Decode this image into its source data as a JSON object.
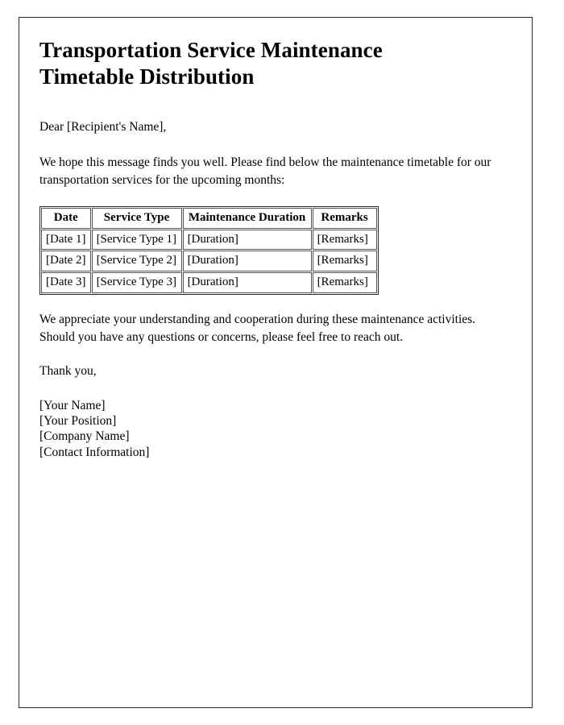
{
  "document": {
    "title": "Transportation Service Maintenance Timetable Distribution",
    "greeting": "Dear [Recipient's Name],",
    "intro_paragraph": "We hope this message finds you well. Please find below the maintenance timetable for our transportation services for the upcoming months:",
    "closing_paragraph": "We appreciate your understanding and cooperation during these maintenance activities. Should you have any questions or concerns, please feel free to reach out.",
    "thanks": "Thank you,",
    "signature": {
      "name": "[Your Name]",
      "position": "[Your Position]",
      "company": "[Company Name]",
      "contact": "[Contact Information]"
    }
  },
  "table": {
    "headers": {
      "date": "Date",
      "service_type": "Service Type",
      "maintenance_duration": "Maintenance Duration",
      "remarks": "Remarks"
    },
    "rows": [
      {
        "date": "[Date 1]",
        "service_type": "[Service Type 1]",
        "duration": "[Duration]",
        "remarks": "[Remarks]"
      },
      {
        "date": "[Date 2]",
        "service_type": "[Service Type 2]",
        "duration": "[Duration]",
        "remarks": "[Remarks]"
      },
      {
        "date": "[Date 3]",
        "service_type": "[Service Type 3]",
        "duration": "[Duration]",
        "remarks": "[Remarks]"
      }
    ]
  },
  "colors": {
    "page_background": "#ffffff",
    "text": "#000000",
    "frame_border": "#2b2b2b",
    "table_border": "#555555"
  }
}
